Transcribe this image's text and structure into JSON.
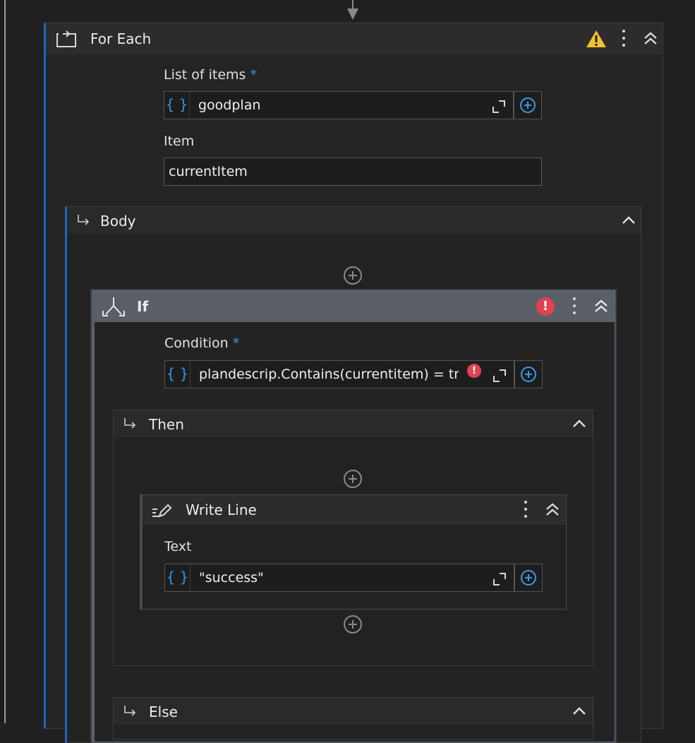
{
  "foreach": {
    "title": "For Each",
    "list_label": "List of items",
    "required_mark": "*",
    "list_value": "goodplan",
    "item_label": "Item",
    "item_value": "currentItem",
    "warning_icon": "warning-icon"
  },
  "body": {
    "label": "Body"
  },
  "if": {
    "title": "If",
    "condition_label": "Condition",
    "required_mark": "*",
    "condition_value": "plandescrip.Contains(currentitem) = true"
  },
  "then": {
    "label": "Then"
  },
  "writeline": {
    "title": "Write Line",
    "text_label": "Text",
    "text_value": "\"success\""
  },
  "else": {
    "label": "Else"
  },
  "glyphs": {
    "brace": "{ }",
    "error": "!"
  },
  "colors": {
    "accent": "#2f97e8",
    "error": "#e0434f",
    "warning": "#f2c12e",
    "active_border": "#1f63c7"
  }
}
